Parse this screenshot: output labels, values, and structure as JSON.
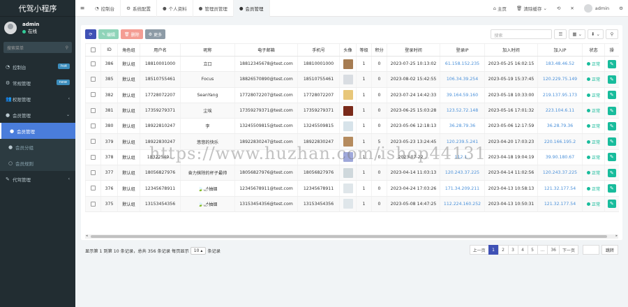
{
  "app": {
    "title": "代驾小程序"
  },
  "user": {
    "name": "admin",
    "status": "在线"
  },
  "sidebar": {
    "search_placeholder": "搜索菜单",
    "items": [
      {
        "label": "控制台",
        "icon": "dashboard-icon",
        "badge": "hot"
      },
      {
        "label": "常规管理",
        "icon": "cog-icon",
        "badge": "new"
      },
      {
        "label": "权限管理",
        "icon": "users-icon"
      },
      {
        "label": "会员管理",
        "icon": "user-icon"
      },
      {
        "label": "会员管理",
        "icon": "user-icon"
      },
      {
        "label": "会员分组",
        "icon": "group-icon"
      },
      {
        "label": "会员规则",
        "icon": "rule-icon"
      },
      {
        "label": "代驾管理",
        "icon": "car-icon"
      }
    ]
  },
  "topbar": {
    "tabs": [
      {
        "label": "控制台",
        "icon": "dashboard-icon"
      },
      {
        "label": "系统配置",
        "icon": "cog-icon"
      },
      {
        "label": "个人资料",
        "icon": "user-icon"
      },
      {
        "label": "管理员管理",
        "icon": "user-icon"
      },
      {
        "label": "会员管理",
        "icon": "user-icon"
      }
    ],
    "right": {
      "home": "主页",
      "clear_cache": "清除缓存",
      "user": "admin"
    }
  },
  "toolbar": {
    "edit": "编辑",
    "delete": "删除",
    "more": "更多",
    "search_placeholder": "搜索"
  },
  "table": {
    "columns": [
      "ID",
      "角色组",
      "用户名",
      "昵称",
      "电子邮箱",
      "手机号",
      "头像",
      "等级",
      "积分",
      "登录时间",
      "登录IP",
      "加入时间",
      "加入IP",
      "状态",
      "操"
    ],
    "rows": [
      {
        "id": "386",
        "group": "默认组",
        "username": "18810001000",
        "nickname": "立口",
        "email": "18812345678@test.com",
        "mobile": "18810001000",
        "level": "1",
        "score": "0",
        "logintime": "2023-07-25 10:13:02",
        "loginip": "61.158.152.235",
        "jointime": "2023-05-25 16:02:15",
        "joinip": "183.48.46.52",
        "status": "正常",
        "avatar": "#a67c52"
      },
      {
        "id": "385",
        "group": "默认组",
        "username": "18510755461",
        "nickname": "Focus",
        "email": "18826570890@test.com",
        "mobile": "18510755461",
        "level": "1",
        "score": "0",
        "logintime": "2023-08-02 15:42:55",
        "loginip": "106.34.39.254",
        "jointime": "2023-05-19 15:37:45",
        "joinip": "120.229.75.149",
        "status": "正常",
        "avatar": "#d9dde2"
      },
      {
        "id": "382",
        "group": "默认组",
        "username": "17728072207",
        "nickname": "SeanYang",
        "email": "17728072207@test.com",
        "mobile": "17728072207",
        "level": "1",
        "score": "0",
        "logintime": "2023-07-24 14:42:33",
        "loginip": "39.164.59.160",
        "jointime": "2023-05-18 10:33:00",
        "joinip": "219.137.95.173",
        "status": "正常",
        "avatar": "#e8c77a"
      },
      {
        "id": "381",
        "group": "默认组",
        "username": "17359279371",
        "nickname": "尘埃",
        "email": "17359279371@test.com",
        "mobile": "17359279371",
        "level": "1",
        "score": "0",
        "logintime": "2023-06-25 15:03:28",
        "loginip": "123.52.72.148",
        "jointime": "2023-05-16 17:01:32",
        "joinip": "223.104.6.11",
        "status": "正常",
        "avatar": "#7a2a1a"
      },
      {
        "id": "380",
        "group": "默认组",
        "username": "18922810247",
        "nickname": "李",
        "email": "13245509815@test.com",
        "mobile": "13245509815",
        "level": "1",
        "score": "0",
        "logintime": "2023-05-06 12:18:13",
        "loginip": "36.28.79.36",
        "jointime": "2023-05-06 12:17:59",
        "joinip": "36.28.79.36",
        "status": "正常",
        "avatar": "#d7e3ea"
      },
      {
        "id": "379",
        "group": "默认组",
        "username": "18922830247",
        "nickname": "悠悠的快乐",
        "email": "18922830247@test.com",
        "mobile": "18922830247",
        "level": "1",
        "score": "5",
        "logintime": "2023-05-23 13:24:45",
        "loginip": "120.239.5.241",
        "jointime": "2023-04-20 17:03:23",
        "joinip": "220.166.195.2",
        "status": "正常",
        "avatar": "#b58b5e"
      },
      {
        "id": "378",
        "group": "默认组",
        "username": "18322549...",
        "nickname": "",
        "email": "",
        "mobile": "",
        "level": "1",
        "score": "0",
        "logintime": "2023-07-22 ...",
        "loginip": "112.1..",
        "jointime": "2023-04-18 19:04:19",
        "joinip": "39.90.180.67",
        "status": "正常",
        "avatar": "#9fa8da"
      },
      {
        "id": "377",
        "group": "默认组",
        "username": "18056827976",
        "nickname": "奋力抹除的杯子最帅",
        "email": "18056827976@test.com",
        "mobile": "18056827976",
        "level": "1",
        "score": "0",
        "logintime": "2023-04-14 11:03:13",
        "loginip": "120.243.37.225",
        "jointime": "2023-04-14 11:02:56",
        "joinip": "120.243.37.225",
        "status": "正常",
        "avatar": "#cfd8dc"
      },
      {
        "id": "376",
        "group": "默认组",
        "username": "12345678911",
        "nickname": "🍃🌶抽烟",
        "email": "12345678911@test.com",
        "mobile": "12345678911",
        "level": "1",
        "score": "0",
        "logintime": "2023-04-24 17:03:26",
        "loginip": "171.34.209.211",
        "jointime": "2023-04-13 10:58:13",
        "joinip": "121.32.177.54",
        "status": "正常",
        "avatar": "#dfe6ea"
      },
      {
        "id": "375",
        "group": "默认组",
        "username": "13153454356",
        "nickname": "🍃🌶抽烟",
        "email": "13153454356@test.com",
        "mobile": "13153454356",
        "level": "1",
        "score": "0",
        "logintime": "2023-05-08 14:47:25",
        "loginip": "112.224.160.252",
        "jointime": "2023-04-13 10:50:31",
        "joinip": "121.32.177.54",
        "status": "正常",
        "avatar": "#dfe6ea"
      }
    ]
  },
  "footer": {
    "info_before": "显示第 1 到第 10 条记录，总共 356 条记录 每页显示",
    "page_size": "10",
    "info_after": "条记录",
    "pages": [
      "上一页",
      "1",
      "2",
      "3",
      "4",
      "5",
      "...",
      "36",
      "下一页"
    ],
    "active_page": "1",
    "go": "跳转"
  },
  "watermark": "https://www.huzhan.com/ishop44131"
}
